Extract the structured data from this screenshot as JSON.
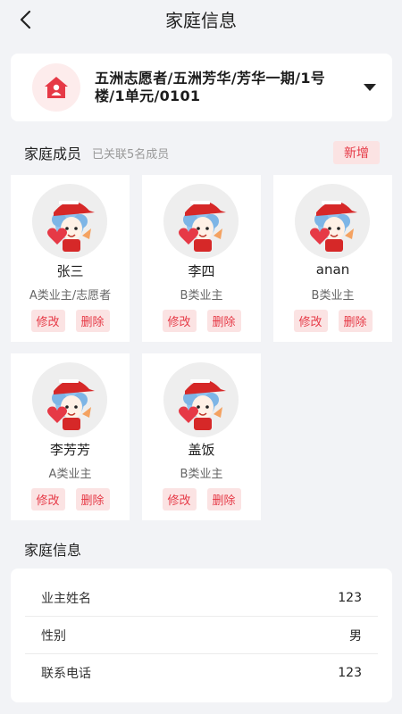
{
  "nav": {
    "title": "家庭信息"
  },
  "address": {
    "text": "五洲志愿者/五洲芳华/芳华一期/1号楼/1单元/0101"
  },
  "members_section": {
    "label": "家庭成员",
    "sub": "已关联5名成员",
    "add_label": "新增"
  },
  "members": [
    {
      "name": "张三",
      "role": "A类业主/志愿者",
      "edit": "修改",
      "delete": "删除"
    },
    {
      "name": "李四",
      "role": "B类业主",
      "edit": "修改",
      "delete": "删除"
    },
    {
      "name": "anan",
      "role": "B类业主",
      "edit": "修改",
      "delete": "删除"
    },
    {
      "name": "李芳芳",
      "role": "A类业主",
      "edit": "修改",
      "delete": "删除"
    },
    {
      "name": "盖饭",
      "role": "B类业主",
      "edit": "修改",
      "delete": "删除"
    }
  ],
  "family_info": {
    "title": "家庭信息",
    "rows": [
      {
        "key": "业主姓名",
        "value": "123"
      },
      {
        "key": "性别",
        "value": "男"
      },
      {
        "key": "联系电话",
        "value": "123"
      }
    ]
  },
  "colors": {
    "accent": "#e63946",
    "accent_bg": "#fbe3e3",
    "page_bg": "#f2f3f6"
  },
  "icons": {
    "back": "chevron-left-icon",
    "house": "house-person-icon",
    "dropdown": "caret-down-icon"
  }
}
